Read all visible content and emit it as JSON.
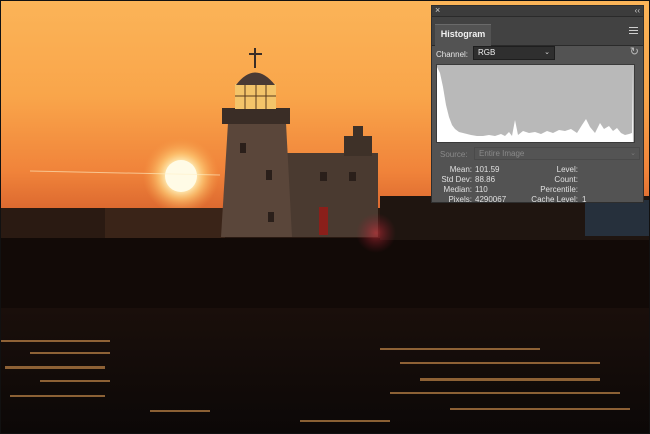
{
  "panel": {
    "title": "Histogram",
    "close_symbol": "×",
    "collapse_symbol": "‹‹",
    "channel_label": "Channel:",
    "channel_value": "RGB",
    "source_label": "Source:",
    "source_value": "Entire Image",
    "stats_left": [
      {
        "label": "Mean:",
        "value": "101.59"
      },
      {
        "label": "Std Dev:",
        "value": "88.86"
      },
      {
        "label": "Median:",
        "value": "110"
      },
      {
        "label": "Pixels:",
        "value": "4290067"
      }
    ],
    "stats_right": [
      {
        "label": "Level:",
        "value": ""
      },
      {
        "label": "Count:",
        "value": ""
      },
      {
        "label": "Percentile:",
        "value": ""
      },
      {
        "label": "Cache Level:",
        "value": "1"
      }
    ]
  },
  "icons": [
    "close-icon",
    "collapse-icon",
    "panel-menu-icon",
    "chevron-down-icon",
    "refresh-icon"
  ],
  "colors": {
    "panel_bg": "#535353",
    "graph_bg": "#b9b9b9",
    "graph_fill": "#ffffff",
    "sky_top": "#fbb256",
    "sun": "#fffbe6"
  }
}
